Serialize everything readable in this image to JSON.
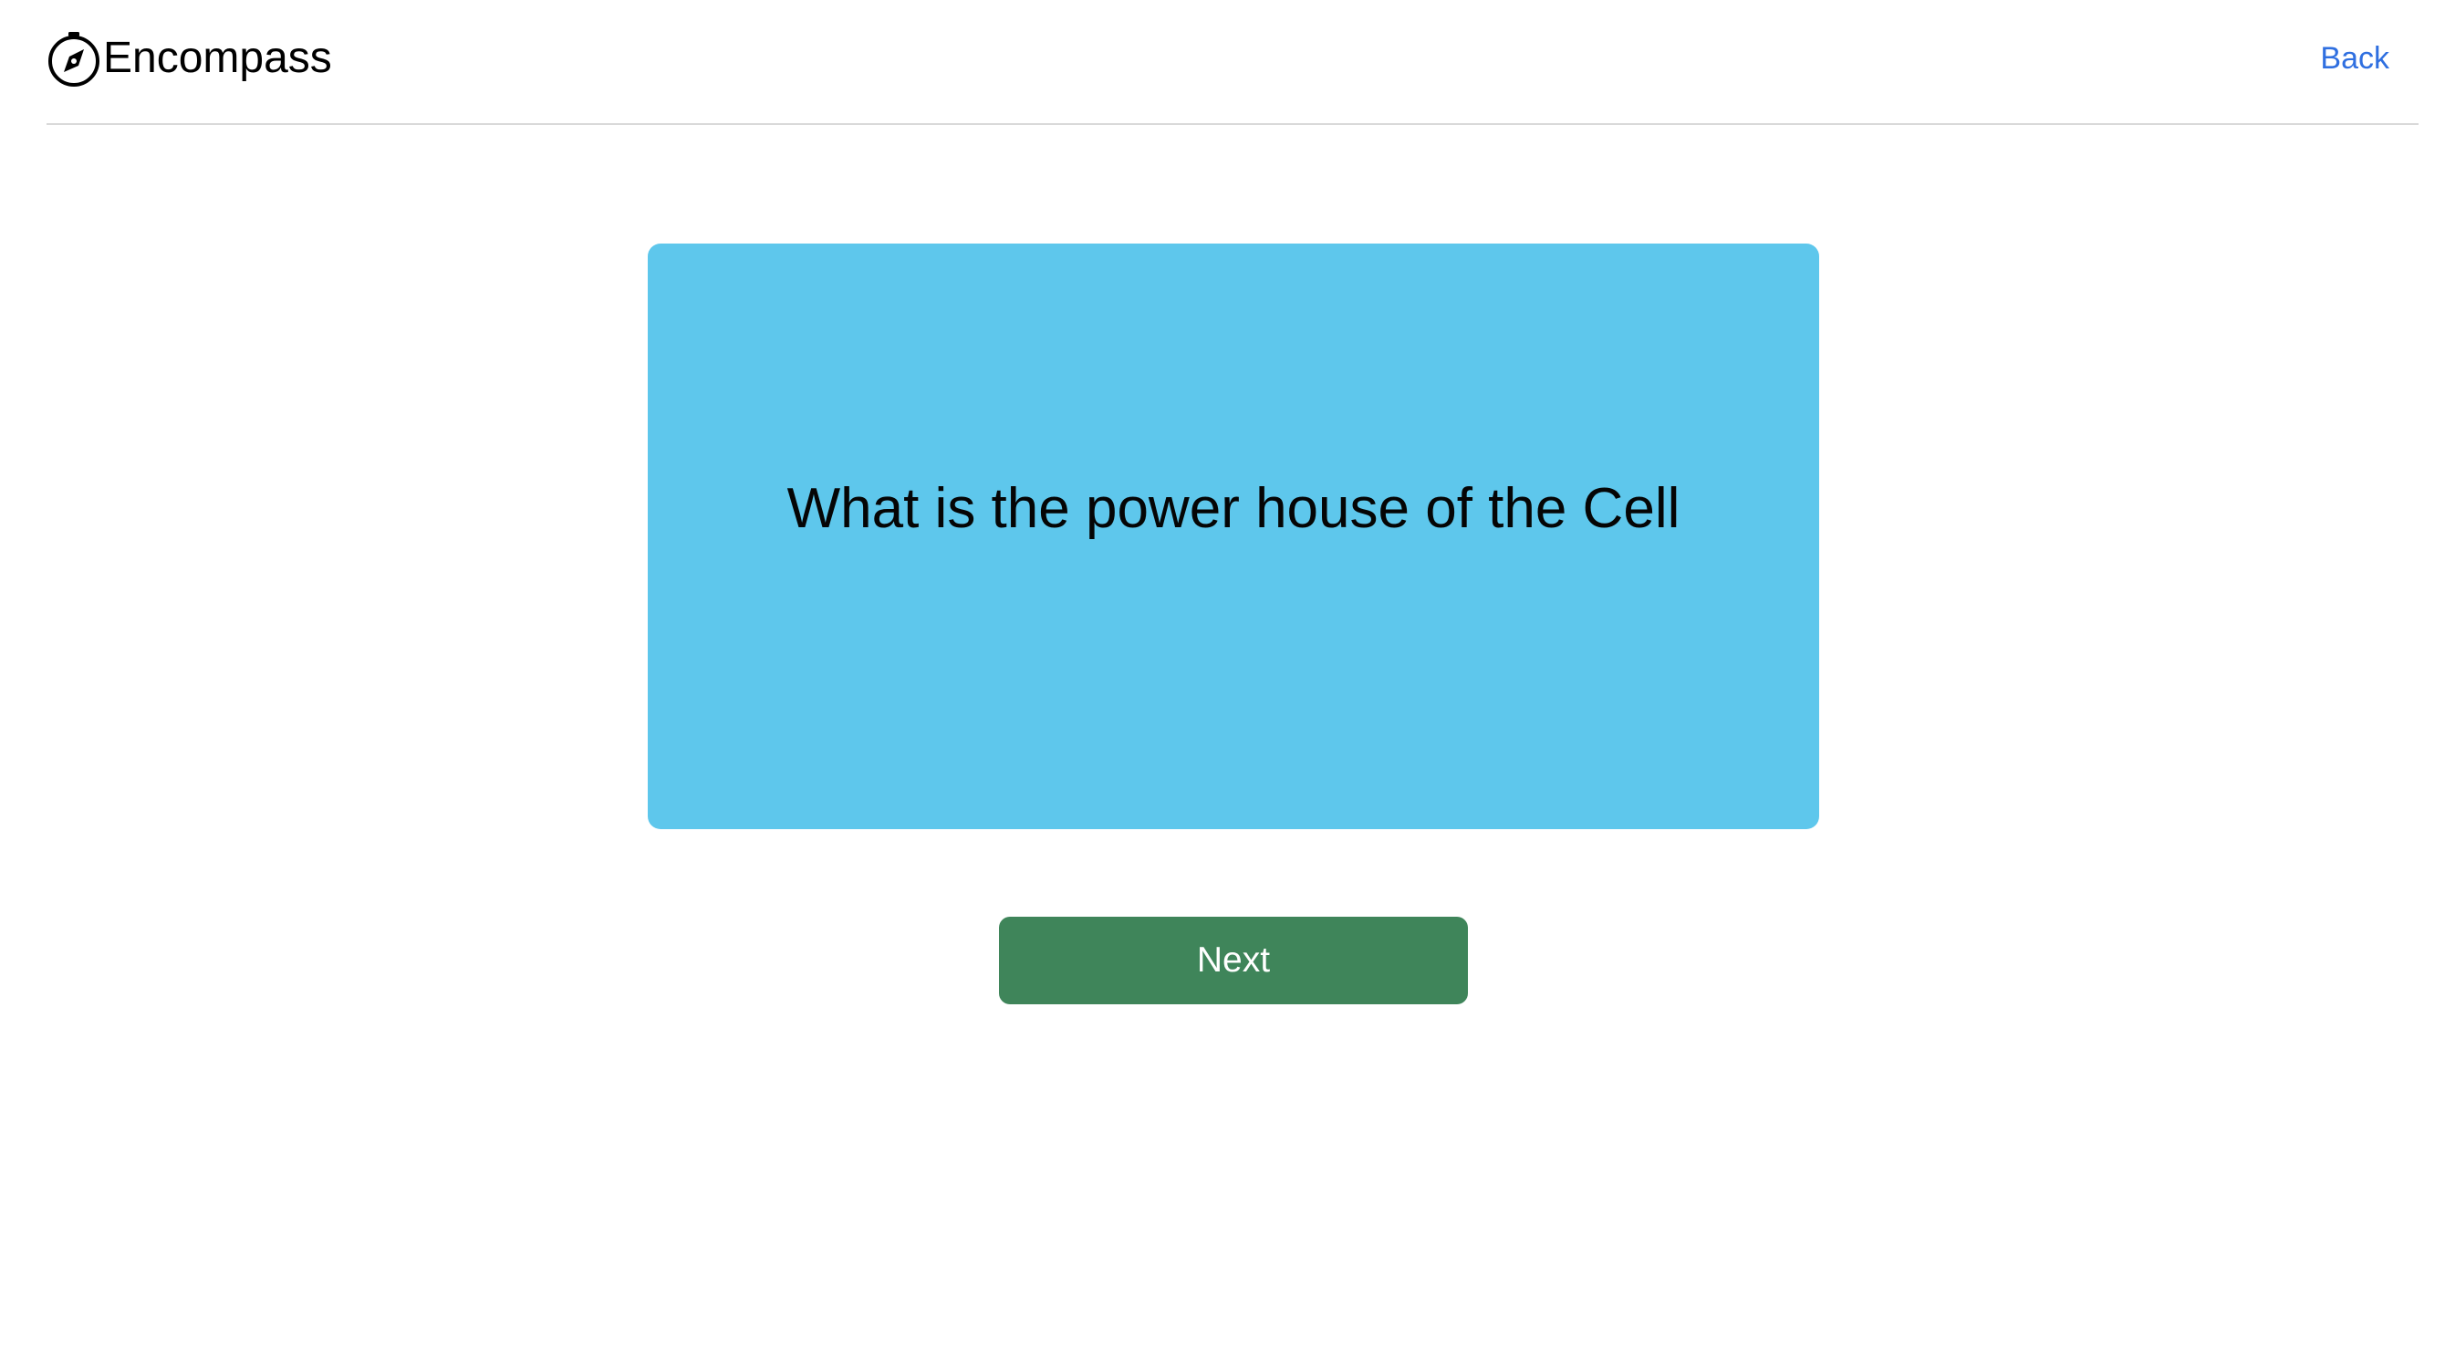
{
  "header": {
    "brand_name": "Encompass",
    "brand_icon": "compass-icon",
    "back_label": "Back"
  },
  "flashcard": {
    "question": "What is the power house of the Cell"
  },
  "actions": {
    "next_label": "Next"
  },
  "colors": {
    "card_background": "#5ec7ec",
    "next_button": "#3f855a",
    "back_link": "#2f6fe0",
    "divider": "#d9d9d9"
  }
}
